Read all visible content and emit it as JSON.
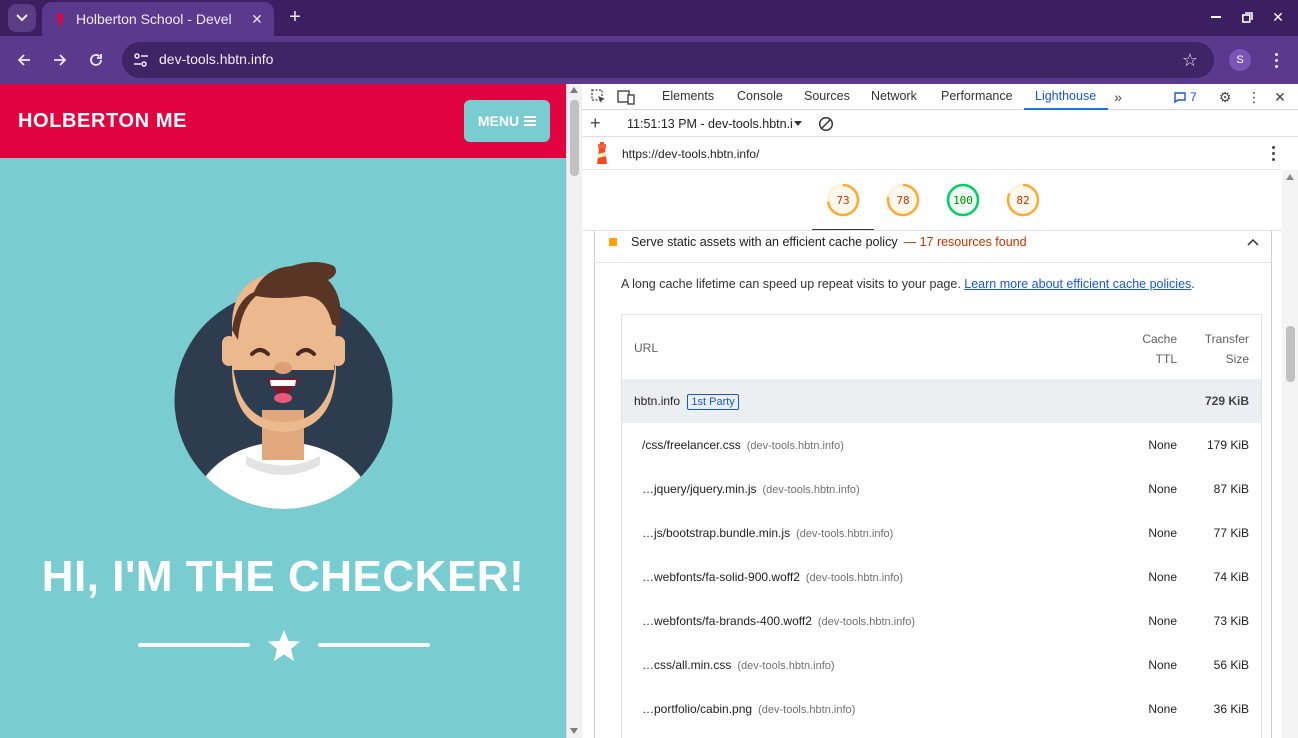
{
  "browser": {
    "tab_title": "Holberton School - Devel",
    "url": "dev-tools.hbtn.info",
    "profile_initial": "S"
  },
  "page": {
    "brand": "HOLBERTON ME",
    "menu_label": "MENU",
    "hero_title": "HI, I'M THE CHECKER!"
  },
  "devtools": {
    "tabs": [
      "Elements",
      "Console",
      "Sources",
      "Network",
      "Performance",
      "Lighthouse"
    ],
    "active_tab": "Lighthouse",
    "issues_count": "7",
    "report_select": "11:51:13 PM - dev-tools.hbtn.i",
    "report_url": "https://dev-tools.hbtn.info/",
    "scores": [
      {
        "value": "73",
        "fraction": 0.73,
        "color": "#fa3"
      },
      {
        "value": "78",
        "fraction": 0.78,
        "color": "#fa3"
      },
      {
        "value": "100",
        "fraction": 1.0,
        "color": "#0c6"
      },
      {
        "value": "82",
        "fraction": 0.82,
        "color": "#fa3"
      }
    ],
    "audit": {
      "title": "Serve static assets with an efficient cache policy",
      "separator": "—",
      "display_value": "17 resources found",
      "description": "A long cache lifetime can speed up repeat visits to your page.",
      "link_text": "Learn more about efficient cache policies",
      "after_link": "."
    },
    "table": {
      "headers": {
        "url": "URL",
        "ttl_line1": "Cache",
        "ttl_line2": "TTL",
        "size_line1": "Transfer",
        "size_line2": "Size"
      },
      "group": {
        "entity": "hbtn.info",
        "badge": "1st Party",
        "size": "729 KiB"
      },
      "rows": [
        {
          "url": "/css/freelancer.css",
          "host": "(dev-tools.hbtn.info)",
          "ttl": "None",
          "size": "179 KiB"
        },
        {
          "url": "…jquery/jquery.min.js",
          "host": "(dev-tools.hbtn.info)",
          "ttl": "None",
          "size": "87 KiB"
        },
        {
          "url": "…js/bootstrap.bundle.min.js",
          "host": "(dev-tools.hbtn.info)",
          "ttl": "None",
          "size": "77 KiB"
        },
        {
          "url": "…webfonts/fa-solid-900.woff2",
          "host": "(dev-tools.hbtn.info)",
          "ttl": "None",
          "size": "74 KiB"
        },
        {
          "url": "…webfonts/fa-brands-400.woff2",
          "host": "(dev-tools.hbtn.info)",
          "ttl": "None",
          "size": "73 KiB"
        },
        {
          "url": "…css/all.min.css",
          "host": "(dev-tools.hbtn.info)",
          "ttl": "None",
          "size": "56 KiB"
        },
        {
          "url": "…portfolio/cabin.png",
          "host": "(dev-tools.hbtn.info)",
          "ttl": "None",
          "size": "36 KiB"
        }
      ]
    }
  },
  "colors": {
    "browser_frame": "#3b1f61",
    "browser_toolbar": "#5b3a8e",
    "site_header": "#e0033f",
    "site_bg": "#79cdd1",
    "devtools_accent": "#1a73e8",
    "audit_warning": "#c33300"
  }
}
